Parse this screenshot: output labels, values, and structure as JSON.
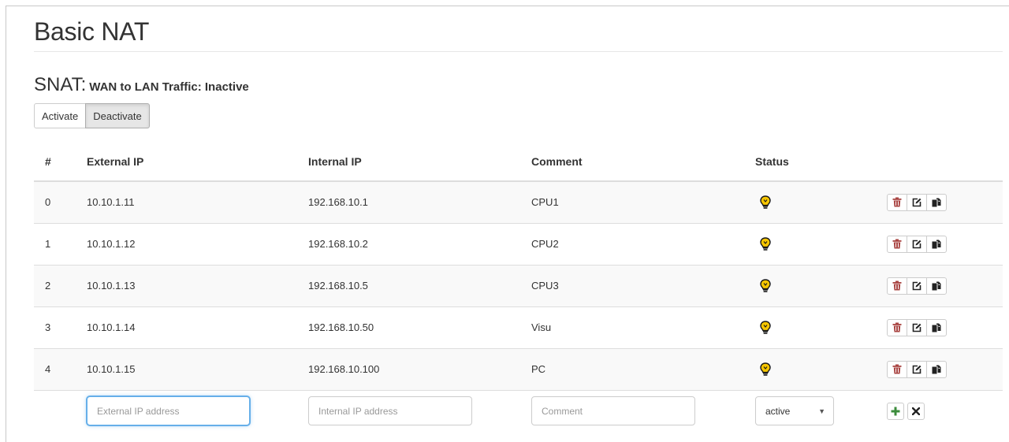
{
  "page": {
    "title": "Basic NAT"
  },
  "section": {
    "heading": "SNAT:",
    "subheading": "WAN to LAN Traffic: Inactive"
  },
  "buttons": {
    "activate": "Activate",
    "deactivate": "Deactivate"
  },
  "table": {
    "headers": {
      "index": "#",
      "external_ip": "External IP",
      "internal_ip": "Internal IP",
      "comment": "Comment",
      "status": "Status"
    },
    "rows": [
      {
        "index": "0",
        "external_ip": "10.10.1.11",
        "internal_ip": "192.168.10.1",
        "comment": "CPU1",
        "status_icon": "lightbulb-icon"
      },
      {
        "index": "1",
        "external_ip": "10.10.1.12",
        "internal_ip": "192.168.10.2",
        "comment": "CPU2",
        "status_icon": "lightbulb-icon"
      },
      {
        "index": "2",
        "external_ip": "10.10.1.13",
        "internal_ip": "192.168.10.5",
        "comment": "CPU3",
        "status_icon": "lightbulb-icon"
      },
      {
        "index": "3",
        "external_ip": "10.10.1.14",
        "internal_ip": "192.168.10.50",
        "comment": "Visu",
        "status_icon": "lightbulb-icon"
      },
      {
        "index": "4",
        "external_ip": "10.10.1.15",
        "internal_ip": "192.168.10.100",
        "comment": "PC",
        "status_icon": "lightbulb-icon"
      }
    ],
    "row_actions": [
      "trash-icon",
      "edit-icon",
      "copy-icon"
    ]
  },
  "new_entry": {
    "external_ip_placeholder": "External IP address",
    "internal_ip_placeholder": "Internal IP address",
    "comment_placeholder": "Comment",
    "status_value": "active",
    "add_icon": "plus-icon",
    "clear_icon": "close-icon"
  },
  "colors": {
    "bulb_fill": "#f7c600",
    "trash": "#a94442",
    "plus": "#3c8c3c",
    "focus": "#66afe9"
  }
}
